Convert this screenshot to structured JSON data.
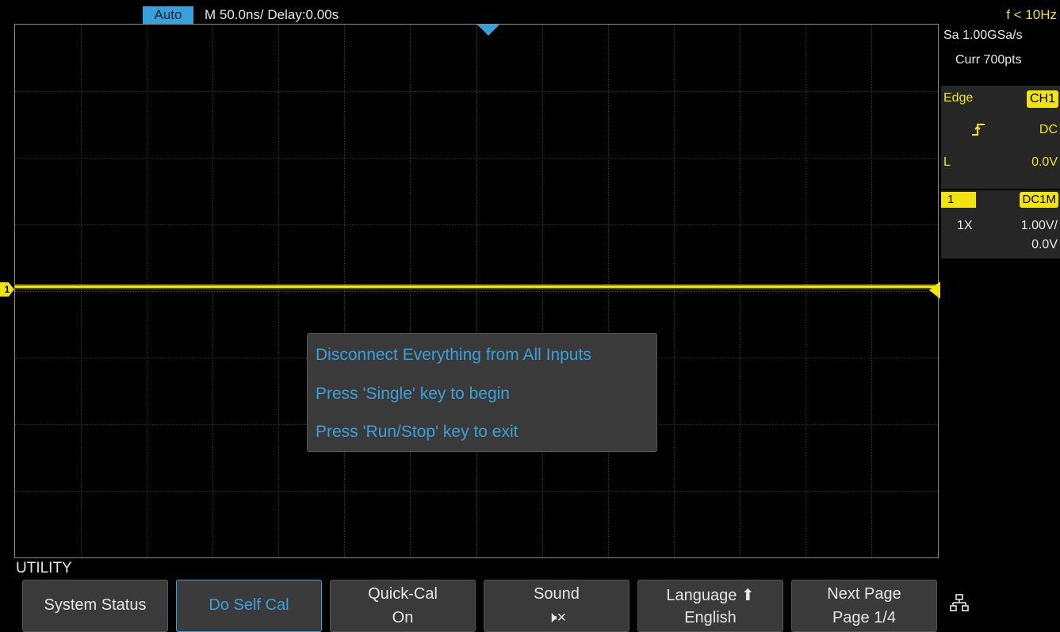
{
  "status_bar": {
    "mode": "Auto",
    "timebase": "M 50.0ns/  Delay:0.00s",
    "frequency": "f < 10Hz"
  },
  "waveform": {
    "channel_marker": "1"
  },
  "dialog": {
    "lines": [
      "Disconnect Everything from All Inputs",
      "Press 'Single' key to begin",
      "Press 'Run/Stop' key to exit"
    ]
  },
  "right_panel": {
    "sample_rate": "Sa 1.00GSa/s",
    "memory": "Curr 700pts",
    "trigger": {
      "type": "Edge",
      "source": "CH1",
      "slope_icon": "rising-edge-icon",
      "coupling": "DC",
      "level_label": "L",
      "level_value": "0.0V"
    },
    "channel": {
      "number": "1",
      "coupling": "DC1M",
      "probe": "1X",
      "scale": "1.00V/",
      "offset": "0.0V"
    }
  },
  "menu": {
    "title": "UTILITY",
    "softkeys": [
      {
        "label": "System Status"
      },
      {
        "label": "Do Self Cal"
      },
      {
        "line1": "Quick-Cal",
        "line2": "On"
      },
      {
        "line1": "Sound",
        "line2": "🕨×"
      },
      {
        "line1": "Language ⬆",
        "line2": "English"
      },
      {
        "line1": "Next Page",
        "line2": "Page 1/4"
      }
    ],
    "network_icon": "network-icon"
  },
  "colors": {
    "trace": "#f2e40d",
    "accent": "#3aa0d9",
    "panel": "#262626",
    "softkey": "#3a3a3a"
  }
}
